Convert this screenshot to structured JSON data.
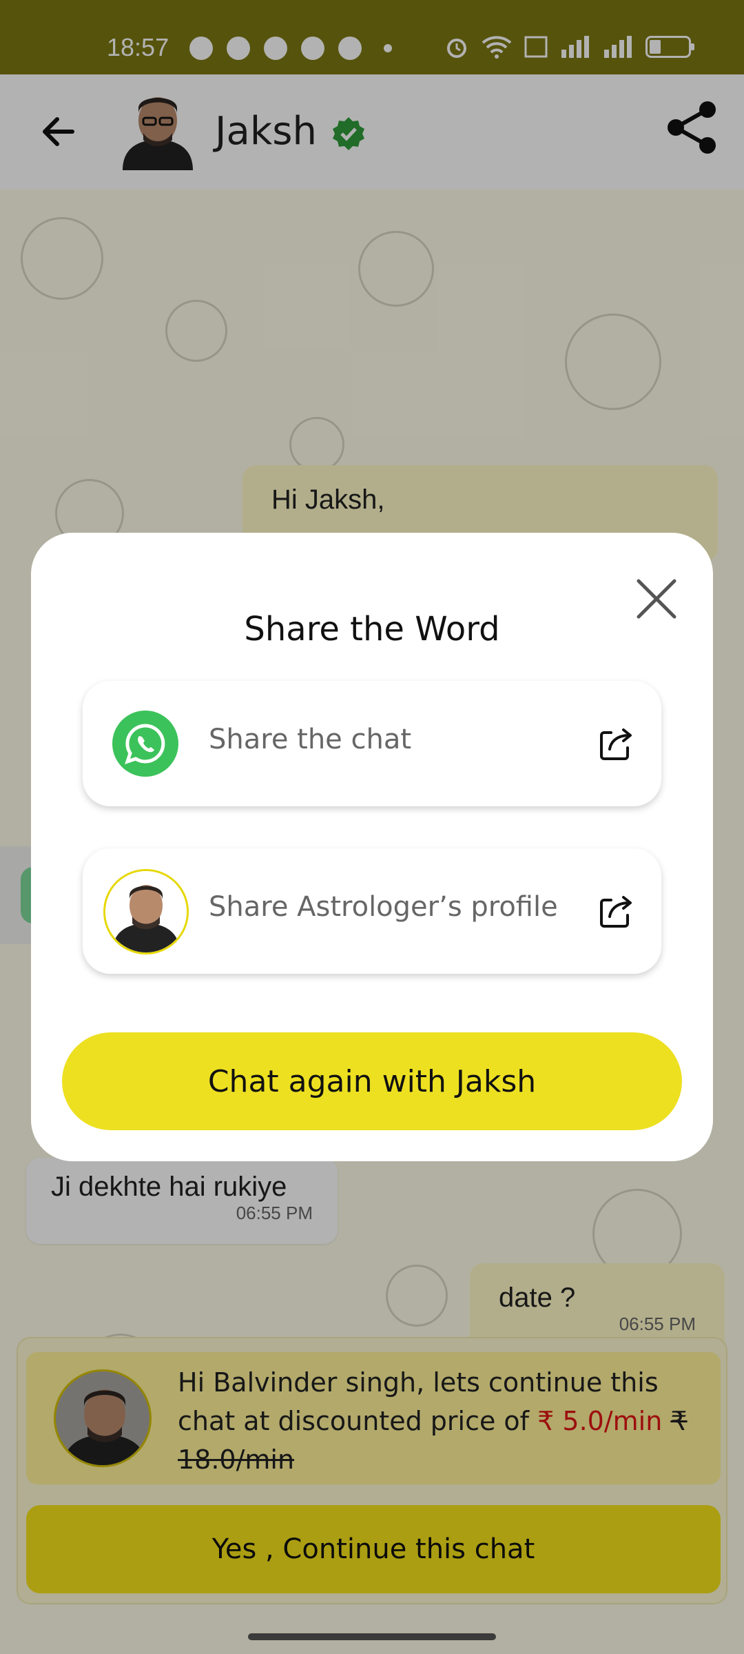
{
  "status_bar": {
    "time": "18:57",
    "left_icons": [
      "whatsapp-icon",
      "skype-icon",
      "chat-icon",
      "telegram-icon",
      "location-icon",
      "dot-icon"
    ],
    "right_icons": [
      "alarm-icon",
      "wifi-icon",
      "volte-icon",
      "signal-icon",
      "signal-icon",
      "battery-icon"
    ]
  },
  "header": {
    "name": "Jaksh",
    "verified_color": "#2e9b3a"
  },
  "chat": {
    "messages": [
      {
        "direction": "out",
        "text": "Hi Jaksh,"
      },
      {
        "direction": "in",
        "text": "Ji dekhte hai rukiye",
        "time": "06:55 PM"
      },
      {
        "direction": "out",
        "text": "date ?",
        "time": "06:55 PM"
      }
    ]
  },
  "promo": {
    "text_part1": "Hi Balvinder singh, lets continue this chat at discounted price of ",
    "new_price": "₹ 5.0/min",
    "old_price": "₹ 18.0/min",
    "button_label": "Yes , Continue this chat"
  },
  "modal": {
    "title": "Share the Word",
    "options": [
      {
        "label": "Share the chat",
        "icon": "whatsapp-icon"
      },
      {
        "label": "Share Astrologer’s profile",
        "icon": "astrologer-avatar"
      }
    ],
    "cta_label": "Chat again with Jaksh"
  },
  "colors": {
    "accent_yellow": "#ede021",
    "whatsapp_green": "#3cc25a",
    "status_bar": "#7c7713",
    "price_red": "#e01515"
  }
}
